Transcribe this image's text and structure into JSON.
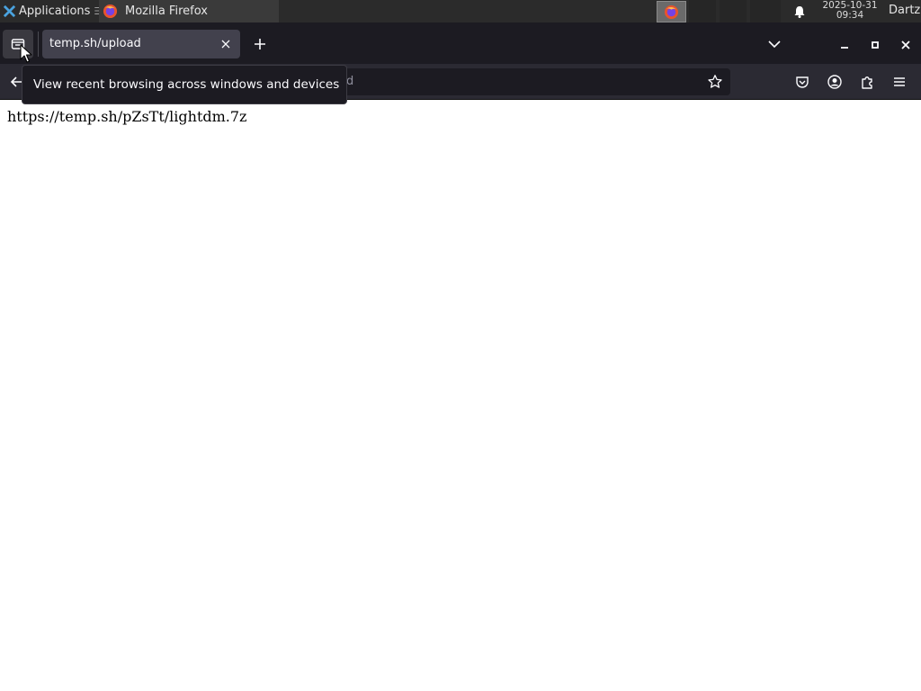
{
  "panel": {
    "applications_label": "Applications",
    "task_title": "Mozilla Firefox",
    "clock_date": "2025-10-31",
    "clock_time": "09:34",
    "user": "Dartz"
  },
  "browser": {
    "tab_title": "temp.sh/upload",
    "url_fragment": "d",
    "tooltip": "View recent browsing across windows and devices"
  },
  "page": {
    "text": "https://temp.sh/pZsTt/lightdm.7z"
  },
  "icons": {
    "apps": "xfce-logo-icon",
    "firefox": "firefox-icon",
    "bell": "bell-icon",
    "firefox_view": "firefox-view-icon",
    "close_tab": "close-icon",
    "new_tab": "plus-icon",
    "tab_list": "chevron-down-icon",
    "back": "back-arrow-icon",
    "bookmark": "star-icon",
    "pocket": "pocket-icon",
    "account": "account-icon",
    "extensions": "puzzle-icon",
    "menu": "hamburger-icon"
  },
  "colors": {
    "panel_bg": "#2b2b2b",
    "tabstrip_bg": "#1c1b22",
    "navbar_bg": "#2b2a33",
    "active_tab_bg": "#42414d"
  }
}
